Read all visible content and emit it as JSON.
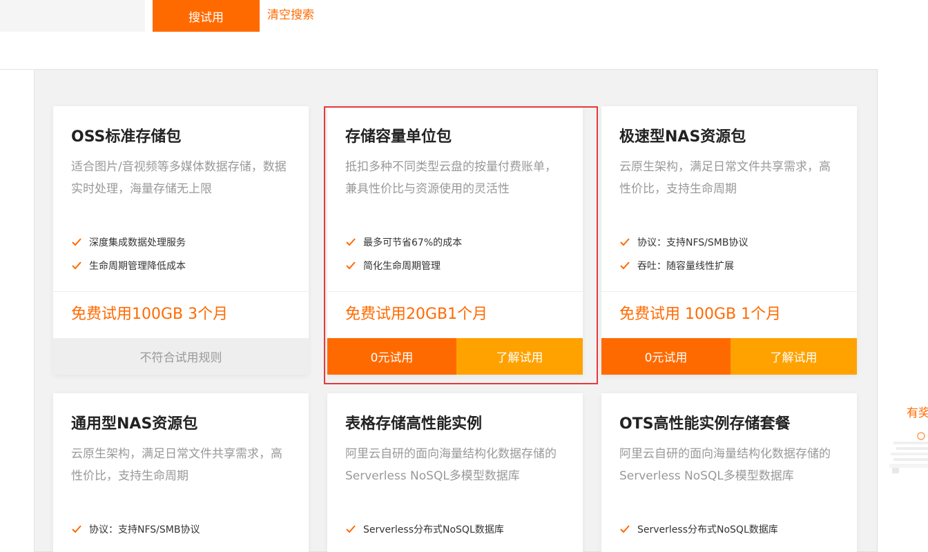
{
  "search": {
    "button_label": "搜试用",
    "clear_label": "清空搜索"
  },
  "cards": [
    {
      "title": "OSS标准存储包",
      "desc": "适合图片/音视频等多媒体数据存储，数据实时处理，海量存储无上限",
      "features": [
        "深度集成数据处理服务",
        "生命周期管理降低成本"
      ],
      "price": "免费试用100GB 3个月",
      "disabled_label": "不符合试用规则"
    },
    {
      "title": "存储容量单位包",
      "desc": "抵扣多种不同类型云盘的按量付费账单，兼具性价比与资源使用的灵活性",
      "features": [
        "最多可节省67%的成本",
        "简化生命周期管理"
      ],
      "price": "免费试用20GB1个月",
      "trial_label": "0元试用",
      "learn_label": "了解试用"
    },
    {
      "title": "极速型NAS资源包",
      "desc": "云原生架构，满足日常文件共享需求，高性价比，支持生命周期",
      "features": [
        "协议：支持NFS/SMB协议",
        "吞吐：随容量线性扩展"
      ],
      "price": "免费试用 100GB 1个月",
      "trial_label": "0元试用",
      "learn_label": "了解试用"
    },
    {
      "title": "通用型NAS资源包",
      "desc": "云原生架构，满足日常文件共享需求，高性价比，支持生命周期",
      "features": [
        "协议：支持NFS/SMB协议"
      ]
    },
    {
      "title": "表格存储高性能实例",
      "desc": "阿里云自研的面向海量结构化数据存储的Serverless NoSQL多模型数据库",
      "features": [
        "Serverless分布式NoSQL数据库"
      ]
    },
    {
      "title": "OTS高性能实例存储套餐",
      "desc": "阿里云自研的面向海量结构化数据存储的Serverless NoSQL多模型数据库",
      "features": [
        "Serverless分布式NoSQL数据库"
      ]
    }
  ],
  "side_widget": {
    "label": "有奖"
  },
  "colors": {
    "accent": "#ff6a00",
    "accent_light": "#ffa200",
    "highlight_border": "#e5383b"
  }
}
